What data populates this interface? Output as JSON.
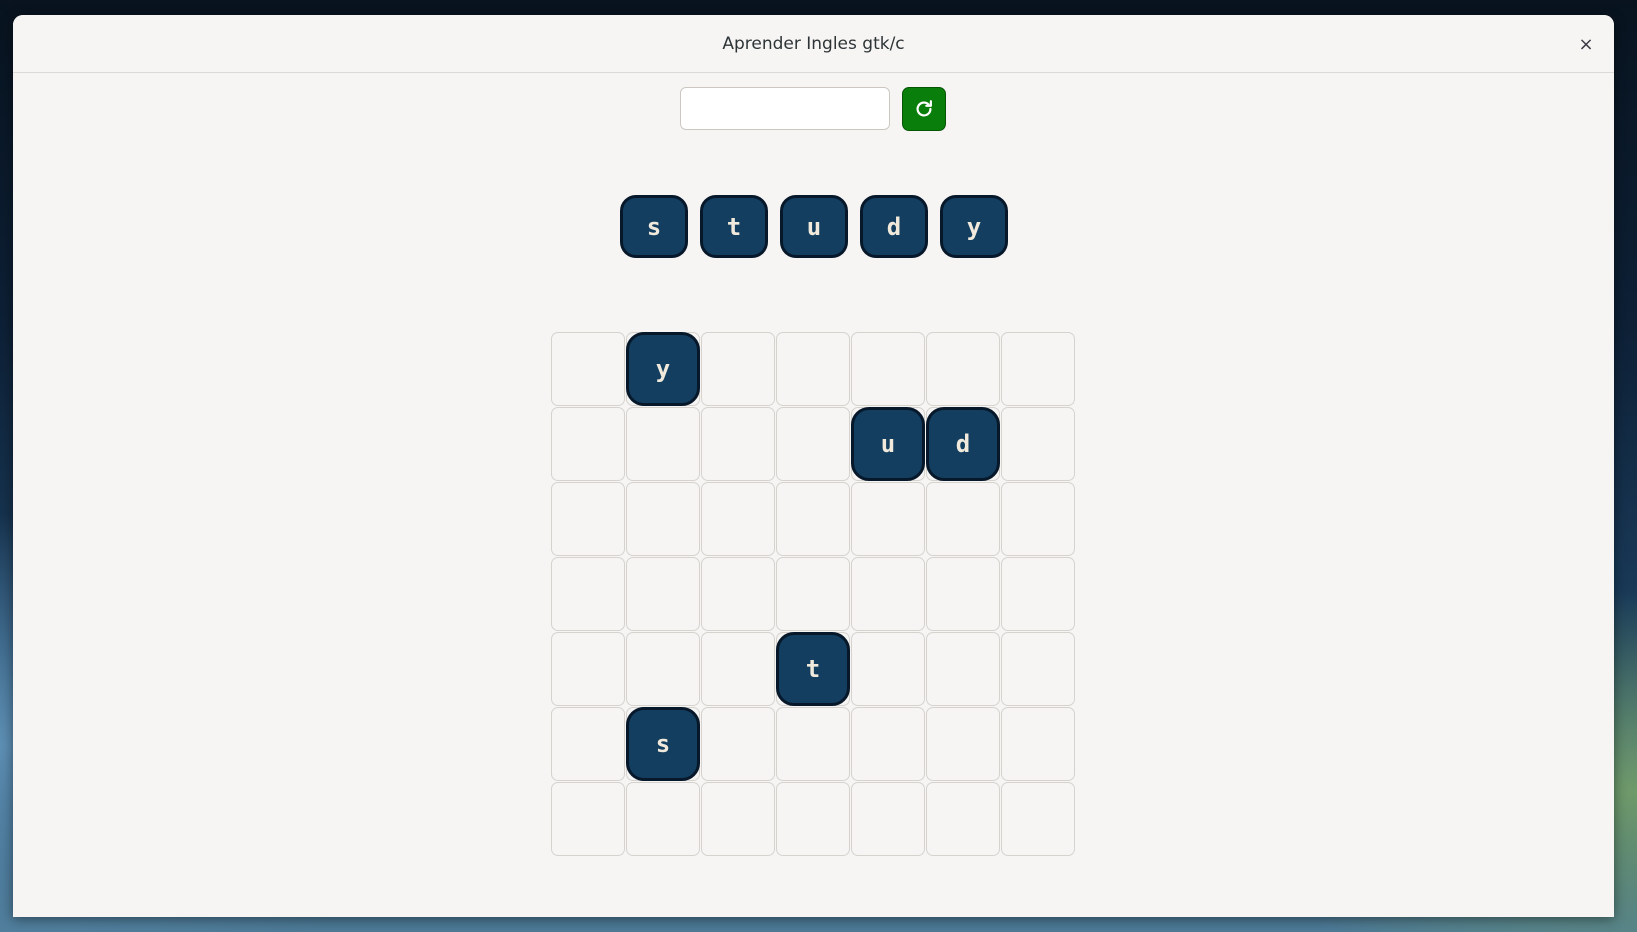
{
  "window": {
    "title": "Aprender Ingles gtk/c",
    "close_glyph": "×"
  },
  "toolbar": {
    "entry_value": "",
    "entry_placeholder": "",
    "refresh_icon": "refresh-icon",
    "refresh_color": "#0a7e0a"
  },
  "letters": [
    "s",
    "t",
    "u",
    "d",
    "y"
  ],
  "board": {
    "rows": 7,
    "cols": 7,
    "placed": [
      {
        "letter": "y",
        "row": 0,
        "col": 1
      },
      {
        "letter": "u",
        "row": 1,
        "col": 4
      },
      {
        "letter": "d",
        "row": 1,
        "col": 5
      },
      {
        "letter": "t",
        "row": 4,
        "col": 3
      },
      {
        "letter": "s",
        "row": 5,
        "col": 1
      }
    ]
  },
  "colors": {
    "tile_fill": "#133e5f",
    "tile_border": "#06182a",
    "tile_text": "#f1eadc"
  }
}
